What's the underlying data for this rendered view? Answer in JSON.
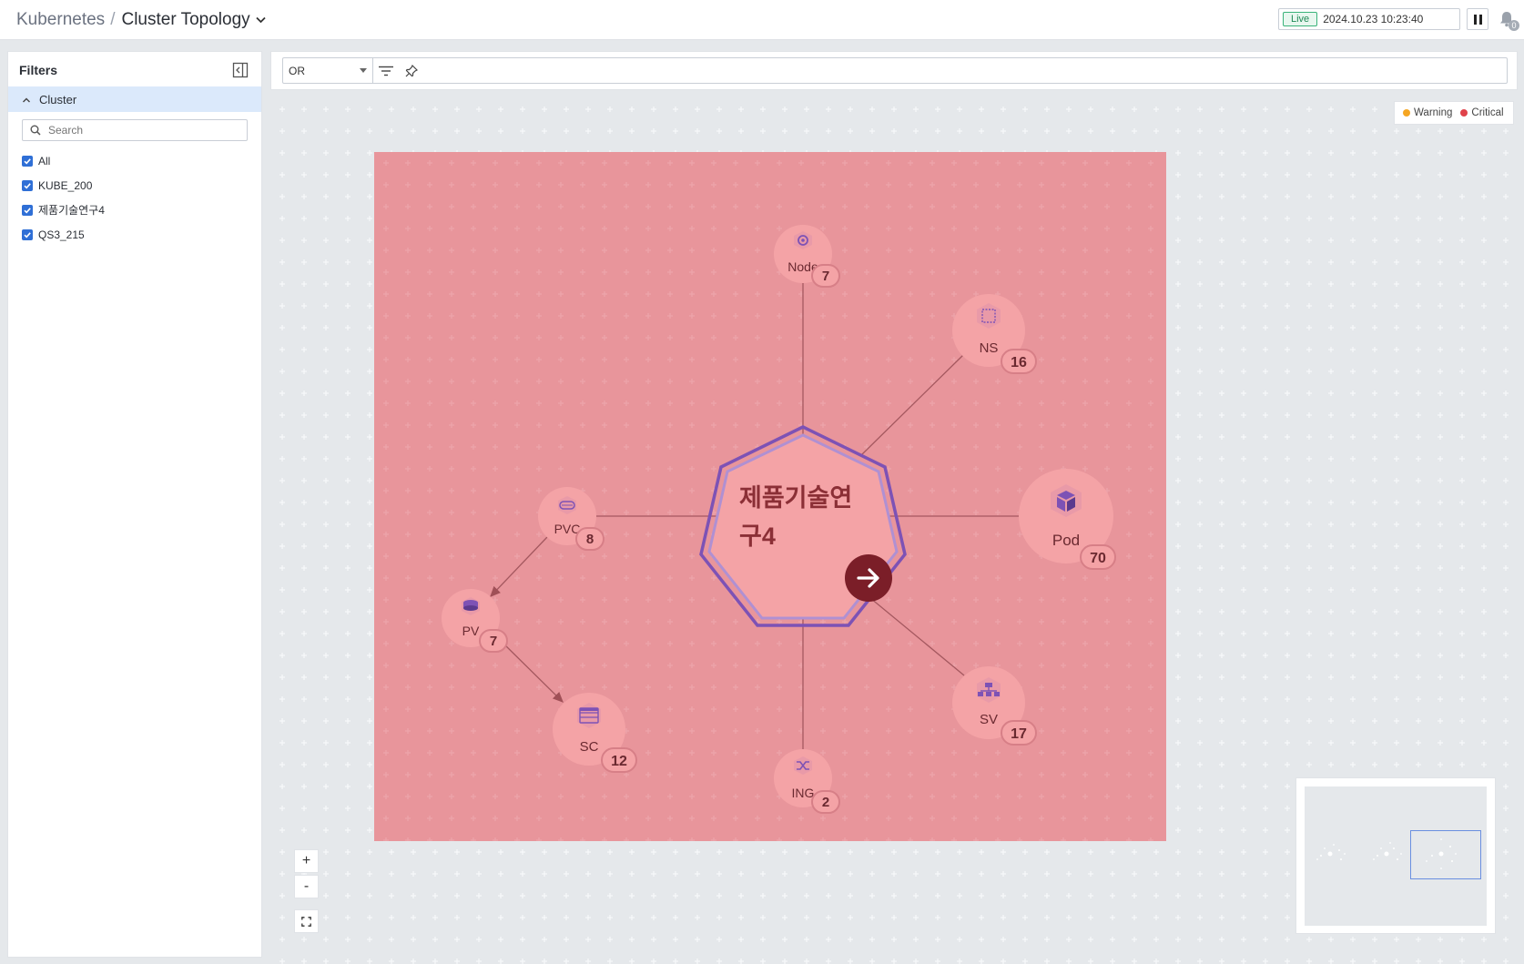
{
  "header": {
    "breadcrumb_root": "Kubernetes",
    "breadcrumb_sep": "/",
    "title": "Cluster Topology",
    "live_label": "Live",
    "timestamp": "2024.10.23 10:23:40",
    "notification_count": "0"
  },
  "sidebar": {
    "title": "Filters",
    "section_label": "Cluster",
    "search_placeholder": "Search",
    "items": [
      {
        "label": "All",
        "checked": true
      },
      {
        "label": "KUBE_200",
        "checked": true
      },
      {
        "label": "제품기술연구4",
        "checked": true
      },
      {
        "label": "QS3_215",
        "checked": true
      }
    ]
  },
  "toolbar": {
    "operator": "OR"
  },
  "legend": {
    "warning_label": "Warning",
    "warning_color": "#f5a623",
    "critical_label": "Critical",
    "critical_color": "#e0424a"
  },
  "topology": {
    "cluster_name_line1": "제품기술연",
    "cluster_name_line2": "구4",
    "status_color": "#e8959b",
    "nodes": {
      "node": {
        "label": "Node",
        "count": "7"
      },
      "ns": {
        "label": "NS",
        "count": "16"
      },
      "pod": {
        "label": "Pod",
        "count": "70"
      },
      "sv": {
        "label": "SV",
        "count": "17"
      },
      "ing": {
        "label": "ING",
        "count": "2"
      },
      "pvc": {
        "label": "PVC",
        "count": "8"
      },
      "pv": {
        "label": "PV",
        "count": "7"
      },
      "sc": {
        "label": "SC",
        "count": "12"
      }
    }
  },
  "zoom": {
    "in_label": "+",
    "out_label": "-"
  }
}
